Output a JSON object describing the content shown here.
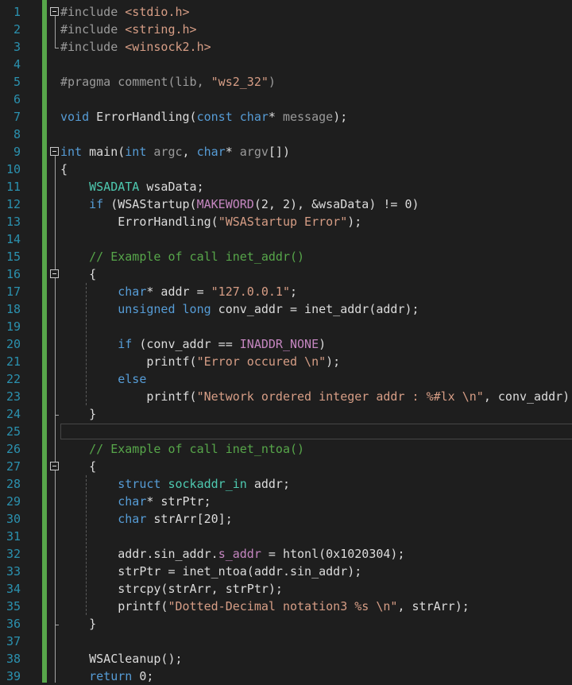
{
  "editor": {
    "language": "C",
    "line_numbers": [
      "1",
      "2",
      "3",
      "4",
      "5",
      "6",
      "7",
      "8",
      "9",
      "10",
      "11",
      "12",
      "13",
      "14",
      "15",
      "16",
      "17",
      "18",
      "19",
      "20",
      "21",
      "22",
      "23",
      "24",
      "25",
      "26",
      "27",
      "28",
      "29",
      "30",
      "31",
      "32",
      "33",
      "34",
      "35",
      "36",
      "37",
      "38",
      "39"
    ],
    "lines": [
      [
        [
          "#include ",
          "pp"
        ],
        [
          "<stdio.h>",
          "str"
        ]
      ],
      [
        [
          "#include ",
          "pp"
        ],
        [
          "<string.h>",
          "str"
        ]
      ],
      [
        [
          "#include ",
          "pp"
        ],
        [
          "<winsock2.h>",
          "str"
        ]
      ],
      [],
      [
        [
          "#pragma comment(lib, ",
          "pp"
        ],
        [
          "\"ws2_32\"",
          "str"
        ],
        [
          ")",
          "pp"
        ]
      ],
      [],
      [
        [
          "void",
          "kw"
        ],
        [
          " ErrorHandling(",
          "fn"
        ],
        [
          "const",
          "kw"
        ],
        [
          " ",
          "fn"
        ],
        [
          "char",
          "kw"
        ],
        [
          "* ",
          "fn"
        ],
        [
          "message",
          "par"
        ],
        [
          ");",
          "fn"
        ]
      ],
      [],
      [
        [
          "int",
          "kw"
        ],
        [
          " main(",
          "fn"
        ],
        [
          "int",
          "kw"
        ],
        [
          " ",
          "fn"
        ],
        [
          "argc",
          "par"
        ],
        [
          ", ",
          "fn"
        ],
        [
          "char",
          "kw"
        ],
        [
          "* ",
          "fn"
        ],
        [
          "argv",
          "par"
        ],
        [
          "[])",
          "fn"
        ]
      ],
      [
        [
          "{",
          "fn"
        ]
      ],
      [
        [
          "    WSADATA",
          "ty"
        ],
        [
          " wsaData;",
          "fn"
        ]
      ],
      [
        [
          "    ",
          "fn"
        ],
        [
          "if",
          "kw"
        ],
        [
          " (WSAStartup(",
          "fn"
        ],
        [
          "MAKEWORD",
          "mac"
        ],
        [
          "(2, 2), &wsaData) != 0)",
          "fn"
        ]
      ],
      [
        [
          "        ErrorHandling(",
          "fn"
        ],
        [
          "\"WSAStartup Error\"",
          "str"
        ],
        [
          ");",
          "fn"
        ]
      ],
      [],
      [
        [
          "    // Example of call inet_addr()",
          "cm"
        ]
      ],
      [
        [
          "    {",
          "fn"
        ]
      ],
      [
        [
          "        ",
          "fn"
        ],
        [
          "char",
          "kw"
        ],
        [
          "* addr = ",
          "fn"
        ],
        [
          "\"127.0.0.1\"",
          "str"
        ],
        [
          ";",
          "fn"
        ]
      ],
      [
        [
          "        ",
          "fn"
        ],
        [
          "unsigned",
          "kw"
        ],
        [
          " ",
          "fn"
        ],
        [
          "long",
          "kw"
        ],
        [
          " conv_addr = inet_addr(addr);",
          "fn"
        ]
      ],
      [],
      [
        [
          "        ",
          "fn"
        ],
        [
          "if",
          "kw"
        ],
        [
          " (conv_addr == ",
          "fn"
        ],
        [
          "INADDR_NONE",
          "mac"
        ],
        [
          ")",
          "fn"
        ]
      ],
      [
        [
          "            printf(",
          "fn"
        ],
        [
          "\"Error occured \\n\"",
          "str"
        ],
        [
          ");",
          "fn"
        ]
      ],
      [
        [
          "        ",
          "fn"
        ],
        [
          "else",
          "kw"
        ]
      ],
      [
        [
          "            printf(",
          "fn"
        ],
        [
          "\"Network ordered integer addr : %#lx \\n\"",
          "str"
        ],
        [
          ", conv_addr);",
          "fn"
        ]
      ],
      [
        [
          "    }",
          "fn"
        ]
      ],
      [],
      [
        [
          "    // Example of call inet_ntoa()",
          "cm"
        ]
      ],
      [
        [
          "    {",
          "fn"
        ]
      ],
      [
        [
          "        ",
          "fn"
        ],
        [
          "struct",
          "kw"
        ],
        [
          " ",
          "fn"
        ],
        [
          "sockaddr_in",
          "ty"
        ],
        [
          " addr;",
          "fn"
        ]
      ],
      [
        [
          "        ",
          "fn"
        ],
        [
          "char",
          "kw"
        ],
        [
          "* strPtr;",
          "fn"
        ]
      ],
      [
        [
          "        ",
          "fn"
        ],
        [
          "char",
          "kw"
        ],
        [
          " strArr[20];",
          "fn"
        ]
      ],
      [],
      [
        [
          "        addr.sin_addr.",
          "fn"
        ],
        [
          "s_addr",
          "mac"
        ],
        [
          " = htonl(0x1020304);",
          "fn"
        ]
      ],
      [
        [
          "        strPtr = inet_ntoa(addr.sin_addr);",
          "fn"
        ]
      ],
      [
        [
          "        strcpy(strArr, strPtr);",
          "fn"
        ]
      ],
      [
        [
          "        printf(",
          "fn"
        ],
        [
          "\"Dotted-Decimal notation3 %s \\n\"",
          "str"
        ],
        [
          ", strArr);",
          "fn"
        ]
      ],
      [
        [
          "    }",
          "fn"
        ]
      ],
      [],
      [
        [
          "    WSACleanup();",
          "fn"
        ]
      ],
      [
        [
          "    ",
          "fn"
        ],
        [
          "return",
          "kw"
        ],
        [
          " 0;",
          "fn"
        ]
      ]
    ],
    "current_line": "25",
    "fold_markers": [
      "1",
      "9",
      "16",
      "27"
    ],
    "colors": {
      "background": "#1e1e1e",
      "keyword": "#569cd6",
      "type": "#4ec9b0",
      "string": "#d69d85",
      "comment": "#57a64a",
      "macro": "#c586c0",
      "line_number": "#2b91af",
      "change_bar": "#57a64a"
    }
  }
}
